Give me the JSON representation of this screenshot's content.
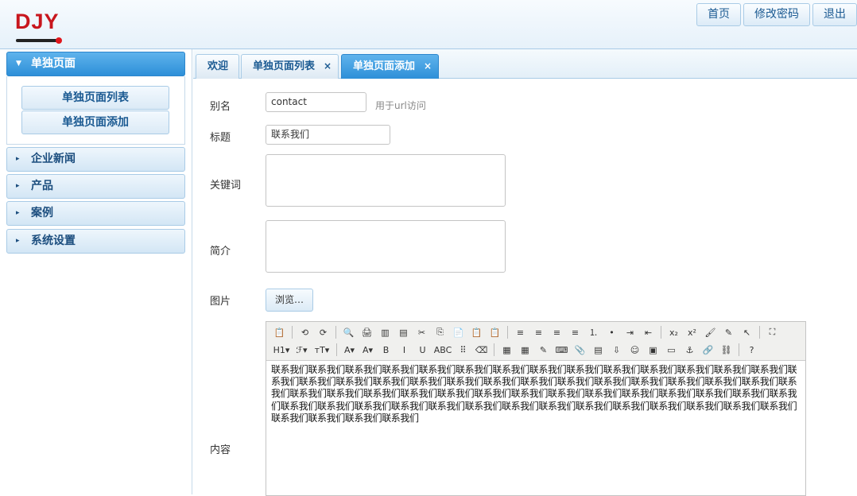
{
  "header": {
    "logo_text": "DJY",
    "nav": [
      "首页",
      "修改密码",
      "退出"
    ]
  },
  "sidebar": {
    "groups": [
      {
        "label": "单独页面",
        "expanded": true
      },
      {
        "label": "企业新闻"
      },
      {
        "label": "产品"
      },
      {
        "label": "案例"
      },
      {
        "label": "系统设置"
      }
    ],
    "subitems": [
      "单独页面列表",
      "单独页面添加"
    ]
  },
  "tabs": [
    {
      "label": "欢迎"
    },
    {
      "label": "单独页面列表",
      "close": "×"
    },
    {
      "label": "单独页面添加",
      "close": "×",
      "active": true
    }
  ],
  "form": {
    "alias_label": "别名",
    "alias_value": "contact",
    "alias_hint": "用于url访问",
    "title_label": "标题",
    "title_value": "联系我们",
    "keywords_label": "关键词",
    "intro_label": "简介",
    "image_label": "图片",
    "browse_label": "浏览…",
    "content_label": "内容",
    "content_text": "联系我们联系我们联系我们联系我们联系我们联系我们联系我们联系我们联系我们联系我们联系我们联系我们联系我们联系我们联系我们联系我们联系我们联系我们联系我们联系我们联系我们联系我们联系我们联系我们联系我们联系我们联系我们联系我们联系我们联系我们联系我们联系我们联系我们联系我们联系我们联系我们联系我们联系我们联系我们联系我们联系我们联系我们联系我们联系我们联系我们联系我们联系我们联系我们联系我们联系我们联系我们联系我们联系我们联系我们联系我们联系我们联系我们联系我们联系我们联系我们联系我们"
  },
  "toolbar": {
    "row1": [
      "📋",
      "⟲",
      "⟳",
      "🔍",
      "🖨",
      "▥",
      "▤",
      "✂",
      "⎘",
      "📄",
      "📋",
      "📋",
      "≡",
      "≡",
      "≡",
      "≡",
      "⒈",
      "•",
      "⇥",
      "⇤",
      "x₂",
      "x²",
      "🖌",
      "✎",
      "↖",
      "⛶"
    ],
    "row2": [
      "H1▾",
      "ℱ▾",
      "ᴛT▾",
      "A▾",
      "A▾",
      "B",
      "I",
      "U",
      "ABC",
      "⠿",
      "⌫",
      "▦",
      "▦",
      "✎",
      "⌨",
      "📎",
      "▤",
      "⇩",
      "☺",
      "▣",
      "▭",
      "⚓",
      "🔗",
      "⛓",
      "?"
    ]
  },
  "colors": {
    "accent": "#2d8fd8",
    "link": "#1b5a92",
    "logo_red": "#c8161d"
  }
}
